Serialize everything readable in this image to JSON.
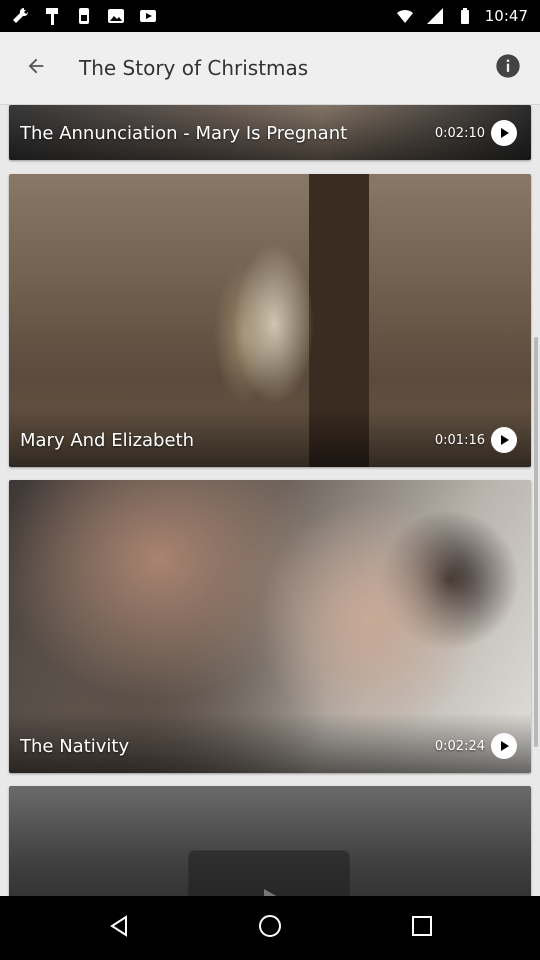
{
  "status_bar": {
    "time": "10:47",
    "left_icons": [
      "wrench-icon",
      "hammer-icon",
      "sim-icon",
      "image-icon",
      "play-store-icon"
    ],
    "right_icons": [
      "wifi-icon",
      "signal-icon",
      "battery-icon"
    ]
  },
  "app_bar": {
    "title": "The Story of Christmas"
  },
  "videos": [
    {
      "title": "The Annunciation - Mary Is Pregnant",
      "duration": "0:02:10"
    },
    {
      "title": "Mary And Elizabeth",
      "duration": "0:01:16"
    },
    {
      "title": "The Nativity",
      "duration": "0:02:24"
    },
    {
      "title": "",
      "duration": ""
    }
  ],
  "nav": {
    "buttons": [
      "back-icon",
      "home-icon",
      "recents-icon"
    ]
  },
  "colors": {
    "status_bar": "#000000",
    "app_bar": "#efefef",
    "text_primary": "#333333",
    "overlay_text": "#ffffff",
    "background": "#e9e9e9"
  }
}
